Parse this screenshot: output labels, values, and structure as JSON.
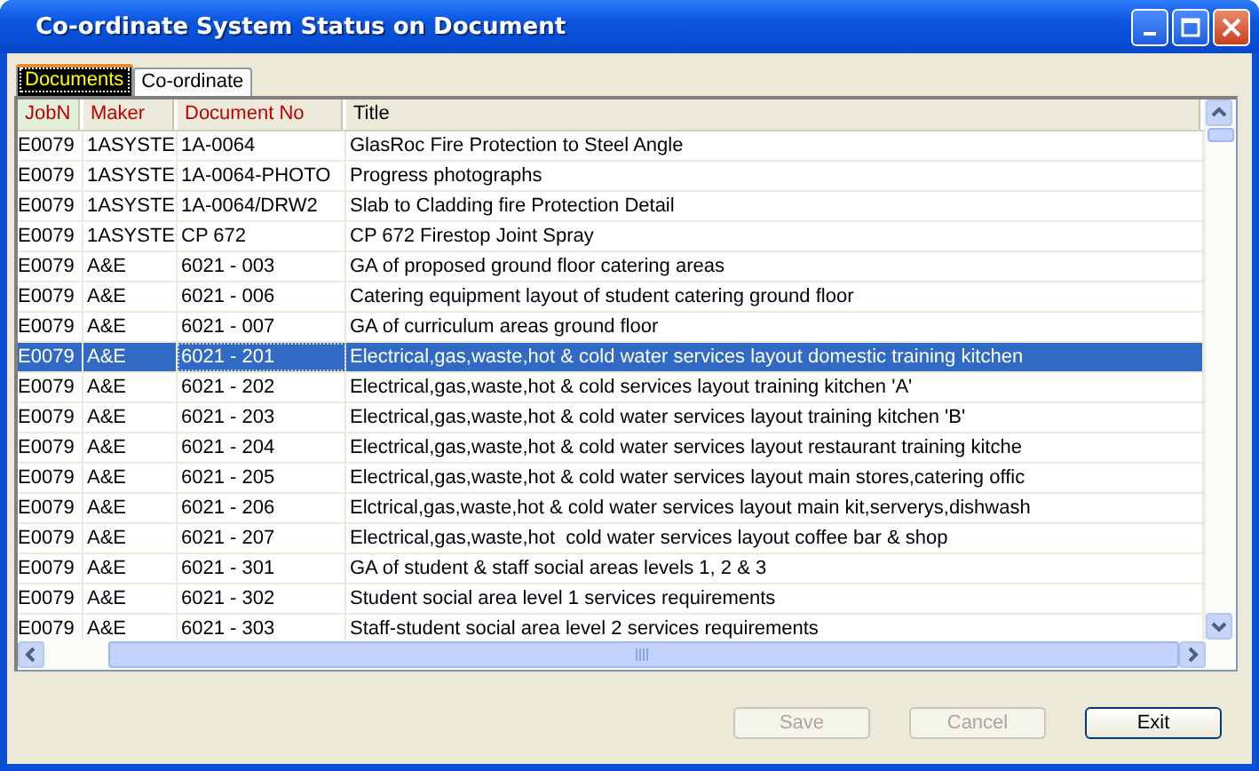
{
  "window": {
    "title": "Co-ordinate System Status on Document"
  },
  "tabs": [
    {
      "label": "Documents",
      "selected": true
    },
    {
      "label": "Co-ordinate",
      "selected": false
    }
  ],
  "table": {
    "columns": [
      "JobN",
      "Maker",
      "Document No",
      "Title"
    ],
    "rows": [
      {
        "cells": [
          "E0079",
          "1ASYSTE",
          "1A-0064",
          "GlasRoc Fire Protection to Steel Angle"
        ],
        "selected": false
      },
      {
        "cells": [
          "E0079",
          "1ASYSTE",
          "1A-0064-PHOTO",
          "Progress photographs"
        ],
        "selected": false
      },
      {
        "cells": [
          "E0079",
          "1ASYSTE",
          "1A-0064/DRW2",
          "Slab to Cladding fire Protection Detail"
        ],
        "selected": false
      },
      {
        "cells": [
          "E0079",
          "1ASYSTE",
          "CP 672",
          "CP 672 Firestop Joint Spray"
        ],
        "selected": false
      },
      {
        "cells": [
          "E0079",
          "A&E",
          "6021 - 003",
          "GA of proposed ground floor catering areas"
        ],
        "selected": false
      },
      {
        "cells": [
          "E0079",
          "A&E",
          "6021 - 006",
          "Catering equipment layout of student catering ground floor"
        ],
        "selected": false
      },
      {
        "cells": [
          "E0079",
          "A&E",
          "6021 - 007",
          "GA of curriculum areas ground floor"
        ],
        "selected": false
      },
      {
        "cells": [
          "E0079",
          "A&E",
          "6021 - 201",
          "Electrical,gas,waste,hot & cold water services layout domestic training kitchen"
        ],
        "selected": true
      },
      {
        "cells": [
          "E0079",
          "A&E",
          "6021 - 202",
          "Electrical,gas,waste,hot & cold services layout training kitchen 'A'"
        ],
        "selected": false
      },
      {
        "cells": [
          "E0079",
          "A&E",
          "6021 - 203",
          "Electrical,gas,waste,hot & cold water services layout training kitchen 'B'"
        ],
        "selected": false
      },
      {
        "cells": [
          "E0079",
          "A&E",
          "6021 - 204",
          "Electrical,gas,waste,hot & cold water services layout restaurant training kitche"
        ],
        "selected": false
      },
      {
        "cells": [
          "E0079",
          "A&E",
          "6021 - 205",
          "Electrical,gas,waste,hot & cold water services layout main stores,catering offic"
        ],
        "selected": false
      },
      {
        "cells": [
          "E0079",
          "A&E",
          "6021 - 206",
          "Elctrical,gas,waste,hot & cold water services layout main kit,serverys,dishwash"
        ],
        "selected": false
      },
      {
        "cells": [
          "E0079",
          "A&E",
          "6021 - 207",
          "Electrical,gas,waste,hot  cold water services layout coffee bar & shop"
        ],
        "selected": false
      },
      {
        "cells": [
          "E0079",
          "A&E",
          "6021 - 301",
          "GA of student & staff social areas levels 1, 2 & 3"
        ],
        "selected": false
      },
      {
        "cells": [
          "E0079",
          "A&E",
          "6021 - 302",
          "Student social area level 1 services requirements"
        ],
        "selected": false
      },
      {
        "cells": [
          "E0079",
          "A&E",
          "6021 - 303",
          "Staff-student social area level 2 services requirements"
        ],
        "selected": false
      }
    ]
  },
  "buttons": [
    {
      "label": "Save",
      "disabled": true
    },
    {
      "label": "Cancel",
      "disabled": true
    },
    {
      "label": "Exit",
      "disabled": false
    }
  ]
}
